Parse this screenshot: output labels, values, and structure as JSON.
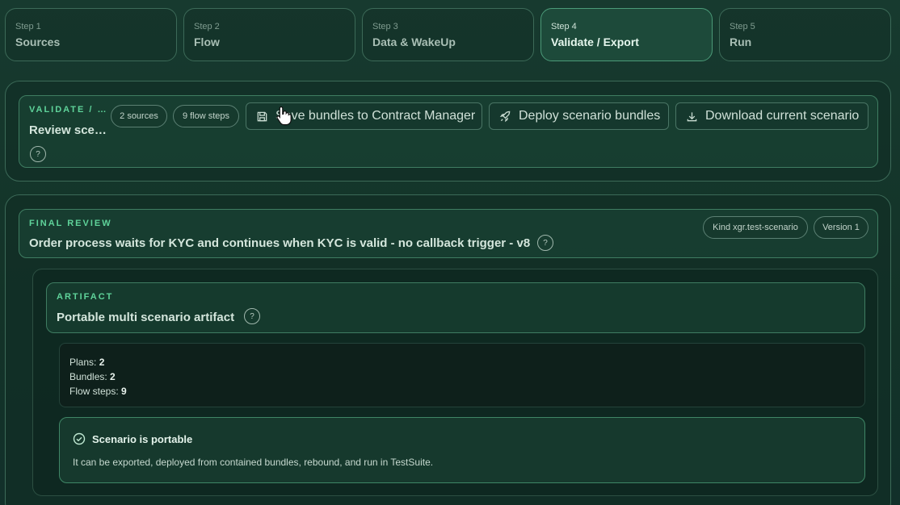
{
  "steps": [
    {
      "num": "Step 1",
      "name": "Sources"
    },
    {
      "num": "Step 2",
      "name": "Flow"
    },
    {
      "num": "Step 3",
      "name": "Data & WakeUp"
    },
    {
      "num": "Step 4",
      "name": "Validate / Export"
    },
    {
      "num": "Step 5",
      "name": "Run"
    }
  ],
  "validate": {
    "eyebrow": "VALIDATE / …",
    "title": "Review sce…",
    "help": "?",
    "sources_badge": "2 sources",
    "flow_badge": "9 flow steps",
    "save_label": "Save bundles to Contract Manager",
    "deploy_label": "Deploy scenario bundles",
    "download_label": "Download current scenario"
  },
  "review": {
    "eyebrow": "FINAL REVIEW",
    "title": "Order process waits for KYC and continues when KYC is valid - no callback trigger - v8",
    "help": "?",
    "kind_badge": "Kind xgr.test-scenario",
    "version_badge": "Version 1"
  },
  "artifact": {
    "eyebrow": "ARTIFACT",
    "title": "Portable multi scenario artifact",
    "help": "?",
    "stats": {
      "plans_label": "Plans:",
      "plans_value": "2",
      "bundles_label": "Bundles:",
      "bundles_value": "2",
      "flow_label": "Flow steps:",
      "flow_value": "9"
    },
    "status": {
      "title": "Scenario is portable",
      "message": "It can be exported, deployed from contained bundles, rebound, and run in TestSuite."
    }
  },
  "colors": {
    "accent": "#5fd39a",
    "background": "#173a2f",
    "active_step": "#1d4a3a"
  }
}
